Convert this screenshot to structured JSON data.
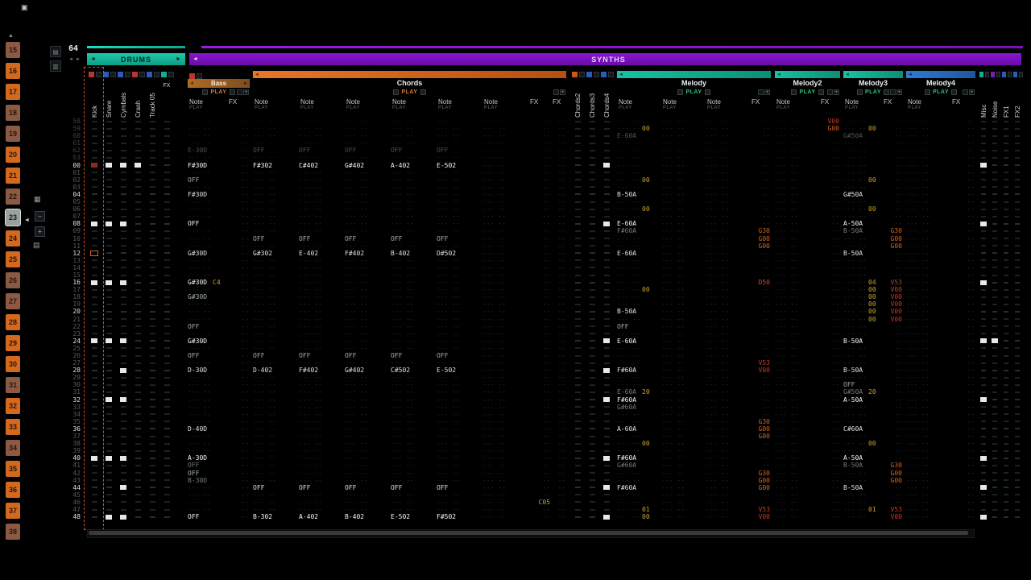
{
  "pattern": {
    "length": "64",
    "pre_rows": [
      "58",
      "59",
      "60",
      "61",
      "62",
      "63"
    ],
    "row_count": 49,
    "cursor": {
      "track": "kick",
      "row": 12
    }
  },
  "palette": {
    "red": "#b8372a",
    "blue": "#2a5cb8",
    "teal": "#14ad96",
    "purple": "#7a1fb5",
    "orange": "#c8581e",
    "slot_on": "#d2691e",
    "slot_dim": "#8a5a45",
    "yellow": "#c9a227"
  },
  "chrome": {
    "scroll_up": "▲",
    "len_dec": "◄",
    "len_inc": "►",
    "panel_arrow": "◄",
    "minus": "–",
    "plus": "+",
    "bar_arrow_left": "◄",
    "bar_arrow_right": "►"
  },
  "icons": {
    "app": "▣",
    "dock1": "▤",
    "dock2": "▥",
    "tool_grid": "▦",
    "tool_layers": "▤"
  },
  "labels": {
    "note": "Note",
    "play": "PLAY",
    "fx": "FX"
  },
  "groups": [
    {
      "id": "drums",
      "label": "DRUMS",
      "left_arrow": "◄",
      "right_arrow": "►"
    },
    {
      "id": "synths",
      "label": "SYNTHS",
      "left_arrow": "◄",
      "right_arrow": ""
    }
  ],
  "slots": {
    "items": [
      {
        "n": "15",
        "state": "dim"
      },
      {
        "n": "16",
        "state": "on"
      },
      {
        "n": "17",
        "state": "on"
      },
      {
        "n": "18",
        "state": "dim"
      },
      {
        "n": "19",
        "state": "dim"
      },
      {
        "n": "20",
        "state": "on"
      },
      {
        "n": "21",
        "state": "on"
      },
      {
        "n": "22",
        "state": "dim"
      },
      {
        "n": "23",
        "state": "selected"
      },
      {
        "n": "24",
        "state": "on"
      },
      {
        "n": "25",
        "state": "on"
      },
      {
        "n": "26",
        "state": "dim"
      },
      {
        "n": "27",
        "state": "dim"
      },
      {
        "n": "28",
        "state": "on"
      },
      {
        "n": "29",
        "state": "on"
      },
      {
        "n": "30",
        "state": "on"
      },
      {
        "n": "31",
        "state": "dim"
      },
      {
        "n": "32",
        "state": "on"
      },
      {
        "n": "33",
        "state": "on"
      },
      {
        "n": "34",
        "state": "dim"
      },
      {
        "n": "35",
        "state": "on"
      },
      {
        "n": "36",
        "state": "on"
      },
      {
        "n": "37",
        "state": "on"
      },
      {
        "n": "38",
        "state": "dim"
      }
    ]
  },
  "tracks": [
    {
      "id": "kick",
      "label": "Kick",
      "kind": "narrow",
      "gap": "",
      "mute": "red",
      "blocks": [
        8,
        16,
        24,
        40
      ],
      "special": {
        "0": "dimred",
        "12": "cursor"
      }
    },
    {
      "id": "snare",
      "label": "Snare",
      "kind": "narrow",
      "gap": "",
      "mute": "blue",
      "blocks": [
        0,
        8,
        16,
        24,
        32,
        40,
        48
      ]
    },
    {
      "id": "cymbals",
      "label": "Cymbals",
      "kind": "narrow",
      "gap": "",
      "mute": "blue",
      "blocks": [
        0,
        8,
        16,
        24,
        28,
        32,
        40,
        44,
        48
      ]
    },
    {
      "id": "crash",
      "label": "Crash",
      "kind": "narrow",
      "gap": "",
      "mute": "red",
      "blocks": [
        0
      ]
    },
    {
      "id": "track05",
      "label": "Track 05",
      "kind": "narrow",
      "gap": "",
      "mute": "blue",
      "blocks": []
    },
    {
      "id": "drumfx",
      "label": "FX",
      "kind": "narrow",
      "hlabel": true,
      "gap": "",
      "mute": "teal",
      "blocks": []
    },
    {
      "id": "bass",
      "label": "Bass",
      "kind": "wide",
      "style": "bass",
      "gap": "A",
      "mute": "red",
      "bar": [
        "#b06a28",
        "#7d4d1d"
      ],
      "play_color": "#d97a2b",
      "cols": [
        {
          "t": "note",
          "wc": "cw49",
          "n": {
            "00": "F#30D",
            "02": "OFF",
            "04": "F#30D",
            "08": "OFF",
            "12": "G#30D",
            "16": "G#30D",
            "18": "G#30D",
            "22": "OFF",
            "24": "G#30D",
            "26": "OFF",
            "28": "D-30D",
            "36": "D-40D",
            "40": "A-30D",
            "41": "OFF",
            "42": "OFF",
            "43": "B-30D",
            "48": "OFF"
          },
          "v": {
            "16": "C4"
          },
          "pn": {
            "62": "E-30D"
          }
        },
        {
          "t": "fx",
          "wc": "cw28",
          "f": {}
        }
      ]
    },
    {
      "id": "chords",
      "label": "Chords",
      "kind": "wide",
      "style": "group",
      "gap": "B",
      "bar": [
        "#e8762a",
        "#b5500f"
      ],
      "play_color": "#d97a2b",
      "cols": [
        {
          "t": "note",
          "wc": "cw57",
          "n": {
            "00": "F#302",
            "10": "OFF",
            "12": "G#302",
            "26": "OFF",
            "28": "D-402",
            "44": "OFF",
            "48": "B-302"
          },
          "pn": {
            "62": "OFF"
          }
        },
        {
          "t": "note",
          "wc": "cw57",
          "n": {
            "00": "C#402",
            "10": "OFF",
            "12": "E-402",
            "26": "OFF",
            "28": "F#402",
            "44": "OFF",
            "48": "A-402"
          },
          "pn": {
            "62": "OFF"
          }
        },
        {
          "t": "note",
          "wc": "cw57",
          "n": {
            "00": "G#402",
            "10": "OFF",
            "12": "F#402",
            "26": "OFF",
            "28": "G#402",
            "44": "OFF",
            "48": "B-402"
          },
          "pn": {
            "62": "OFF"
          }
        },
        {
          "t": "note",
          "wc": "cw57",
          "n": {
            "00": "A-402",
            "10": "OFF",
            "12": "B-402",
            "26": "OFF",
            "28": "C#502",
            "44": "OFF",
            "48": "E-502"
          },
          "pn": {
            "62": "OFF"
          }
        },
        {
          "t": "note",
          "wc": "cw57",
          "n": {
            "00": "E-502",
            "10": "OFF",
            "12": "D#502",
            "26": "OFF",
            "28": "E-502",
            "44": "OFF",
            "48": "F#502"
          },
          "pn": {
            "62": "OFF"
          }
        },
        {
          "t": "note",
          "wc": "cw57",
          "n": {}
        },
        {
          "t": "fx",
          "wc": "cw28",
          "f": {
            "46": "C05"
          }
        },
        {
          "t": "fx",
          "wc": "cw19",
          "f": {}
        }
      ]
    },
    {
      "id": "chords2",
      "label": "Chords2",
      "kind": "narrow",
      "gap": "C",
      "mute": "orange",
      "blocks": []
    },
    {
      "id": "chords3",
      "label": "Chords3",
      "kind": "narrow",
      "gap": "",
      "mute": "blue",
      "blocks": []
    },
    {
      "id": "chords4",
      "label": "Chords4",
      "kind": "narrow",
      "gap": "",
      "mute": "blue",
      "blocks": [
        0,
        8,
        24,
        28,
        32,
        40,
        44,
        48
      ]
    },
    {
      "id": "melody",
      "label": "Melody",
      "kind": "wide",
      "style": "group",
      "gap": "B",
      "bar": [
        "#17c2a4",
        "#0b8f77"
      ],
      "play_color": "#2ec27e",
      "cols": [
        {
          "t": "note",
          "wc": "cw55",
          "n": {
            "04": "B-50A",
            "08": "E-60A",
            "09": "F#60A",
            "12": "E-60A",
            "20": "B-50A",
            "22": "OFF",
            "24": "E-60A",
            "28": "F#60A",
            "31": "E-60A",
            "32": "F#60A",
            "33": "G#60A",
            "36": "A-60A",
            "40": "F#60A",
            "41": "G#60A",
            "44": "F#60A"
          },
          "v": {
            "02": "00",
            "06": "00",
            "17": "00",
            "31": "20",
            "38": "00",
            "47": "01",
            "48": "00"
          },
          "pn": {
            "60": "E-60A"
          },
          "pv": {
            "59": "00"
          }
        },
        {
          "t": "note",
          "wc": "cw55",
          "n": {}
        },
        {
          "t": "note",
          "wc": "cw55",
          "n": {}
        },
        {
          "t": "fx",
          "wc": "cw26",
          "f": {
            "09": "G30",
            "10": "G00",
            "11": "G00",
            "16": "D50",
            "27": "V53",
            "28": "V00",
            "35": "G30",
            "36": "G00",
            "37": "G00",
            "42": "G30",
            "43": "G00",
            "44": "G00",
            "47": "V53",
            "48": "V00"
          }
        }
      ]
    },
    {
      "id": "melody2",
      "label": "Melody2",
      "kind": "wide",
      "style": "group",
      "gap": "C",
      "bar": [
        "#17c2a4",
        "#0b8f77"
      ],
      "play_color": "#2ec27e",
      "cols": [
        {
          "t": "note",
          "wc": "cw55",
          "n": {}
        },
        {
          "t": "fx",
          "wc": "cw26",
          "f": {},
          "pf": {
            "58": "V00",
            "59": "G00"
          }
        }
      ]
    },
    {
      "id": "melody3",
      "label": "Melody3",
      "kind": "wide",
      "style": "group",
      "gap": "B",
      "bar": [
        "#17c2a4",
        "#0b8f77"
      ],
      "play_color": "#2ec27e",
      "cols": [
        {
          "t": "note",
          "wc": "cw48",
          "n": {
            "04": "G#50A",
            "08": "A-50A",
            "09": "B-50A",
            "12": "B-50A",
            "24": "B-50A",
            "28": "B-50A",
            "30": "OFF",
            "31": "G#50A",
            "32": "A-50A",
            "36": "C#60A",
            "40": "A-50A",
            "41": "B-50A",
            "44": "B-50A"
          },
          "v": {
            "02": "00",
            "06": "00",
            "16": "04",
            "17": "00",
            "18": "00",
            "19": "00",
            "20": "00",
            "21": "00",
            "31": "20",
            "38": "00",
            "47": "01"
          },
          "pn": {
            "60": "G#50A"
          },
          "pv": {
            "59": "00"
          }
        },
        {
          "t": "fx",
          "wc": "cw26",
          "f": {
            "09": "G30",
            "10": "G00",
            "11": "G00",
            "16": "V53",
            "17": "V00",
            "18": "V00",
            "19": "V00",
            "20": "V00",
            "21": "V00",
            "41": "G30",
            "42": "G00",
            "43": "G00",
            "47": "V53",
            "48": "V00"
          }
        }
      ]
    },
    {
      "id": "melody4",
      "label": "Melody4",
      "kind": "wide",
      "style": "group",
      "gap": "B",
      "bar": [
        "#2e7bd6",
        "#1f55a0"
      ],
      "play_color": "#2ec27e",
      "cols": [
        {
          "t": "note",
          "wc": "cw55",
          "n": {}
        },
        {
          "t": "fx",
          "wc": "cw31",
          "f": {}
        }
      ]
    },
    {
      "id": "misc",
      "label": "Misc",
      "kind": "rnarrow",
      "gap": "D",
      "mute": "teal",
      "blocks": [
        0,
        8,
        16,
        24,
        32,
        40,
        44,
        48
      ]
    },
    {
      "id": "noise",
      "label": "Noise",
      "kind": "rnarrow",
      "gap": "",
      "mute": "purple",
      "blocks": [
        24
      ]
    },
    {
      "id": "fx1",
      "label": "FX1",
      "kind": "rnarrow",
      "gap": "",
      "mute": "blue",
      "blocks": []
    },
    {
      "id": "fx2",
      "label": "FX2",
      "kind": "rnarrow",
      "gap": "",
      "mute": "blue",
      "blocks": []
    }
  ]
}
